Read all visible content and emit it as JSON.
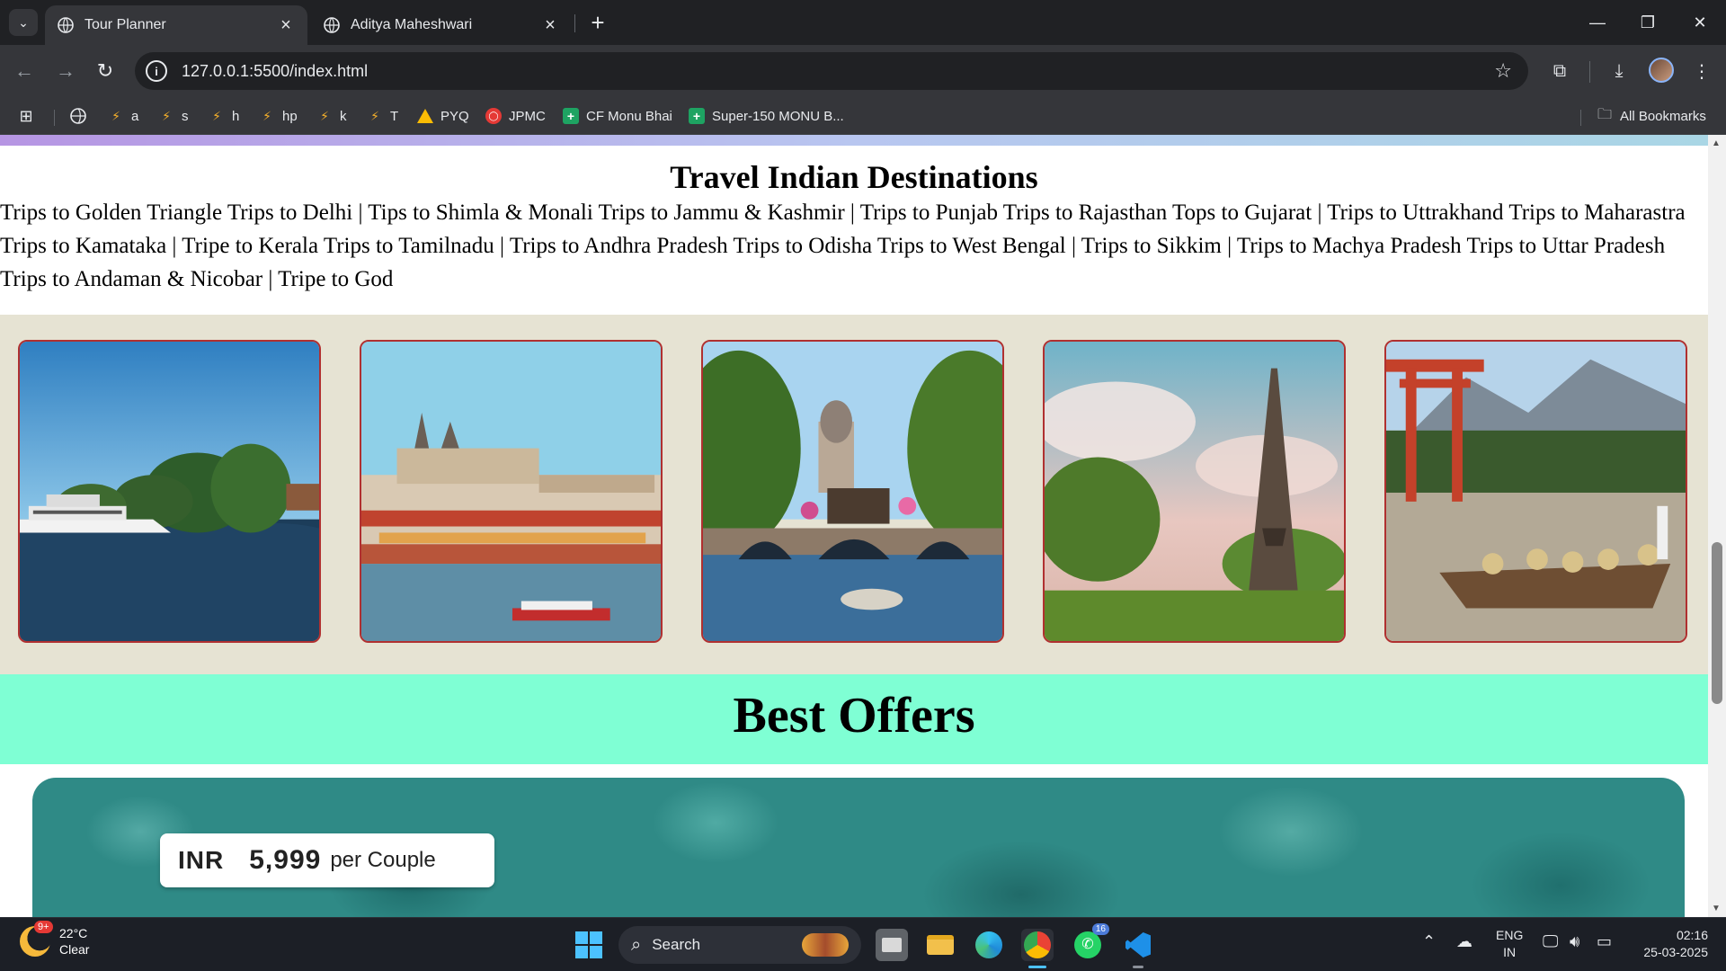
{
  "browser": {
    "tabs": [
      {
        "title": "Tour Planner",
        "active": true
      },
      {
        "title": "Aditya Maheshwari",
        "active": false
      }
    ],
    "url": "127.0.0.1:5500/index.html",
    "bookmarks": [
      {
        "label": "a",
        "icon": "codeforces-icon"
      },
      {
        "label": "s",
        "icon": "codeforces-icon"
      },
      {
        "label": "h",
        "icon": "codeforces-icon"
      },
      {
        "label": "hp",
        "icon": "codeforces-icon"
      },
      {
        "label": "k",
        "icon": "codeforces-icon"
      },
      {
        "label": "T",
        "icon": "codeforces-icon"
      },
      {
        "label": "PYQ",
        "icon": "google-drive-icon"
      },
      {
        "label": "JPMC",
        "icon": "oracle-icon"
      },
      {
        "label": "CF Monu Bhai",
        "icon": "sheets-icon"
      },
      {
        "label": "Super-150 MONU B...",
        "icon": "sheets-icon"
      }
    ],
    "all_bookmarks_label": "All Bookmarks"
  },
  "page": {
    "destinations_title": "Travel Indian Destinations",
    "destinations_lines": [
      "Trips to Golden Triangle Trips to Delhi | Tips to Shimla & Monali Trips to Jammu & Kashmir | Trips to Punjab Trips to Rajasthan Tops to Gujarat | Trips to Uttrakhand Trips to Maharastra",
      "Trips to Kamataka | Tripe to Kerala Trips to Tamilnadu | Trips to Andhra Pradesh Trips to Odisha Trips to West Bengal | Trips to Sikkim | Trips to Machya Pradesh Trips to Uttar Pradesh",
      "Trips to Andaman & Nicobar | Tripe to God"
    ],
    "gallery": [
      {
        "name": "boat-lake-photo"
      },
      {
        "name": "prague-castle-photo"
      },
      {
        "name": "amsterdam-canal-photo"
      },
      {
        "name": "eiffel-tower-photo"
      },
      {
        "name": "torii-gate-boat-photo"
      }
    ],
    "offers_title": "Best Offers",
    "offer": {
      "currency": "INR",
      "amount": "5,999",
      "unit": "per Couple"
    }
  },
  "taskbar": {
    "weather": {
      "temp": "22°C",
      "condition": "Clear",
      "badge": "9+"
    },
    "search_label": "Search",
    "whatsapp_badge": "16",
    "lang_top": "ENG",
    "lang_bottom": "IN",
    "time": "02:16",
    "date": "25-03-2025"
  },
  "colors": {
    "offers_band": "#7fffd4",
    "gallery_bg": "#e6e3d3",
    "card_border": "#b03030",
    "accent": "#4cc2ff"
  }
}
